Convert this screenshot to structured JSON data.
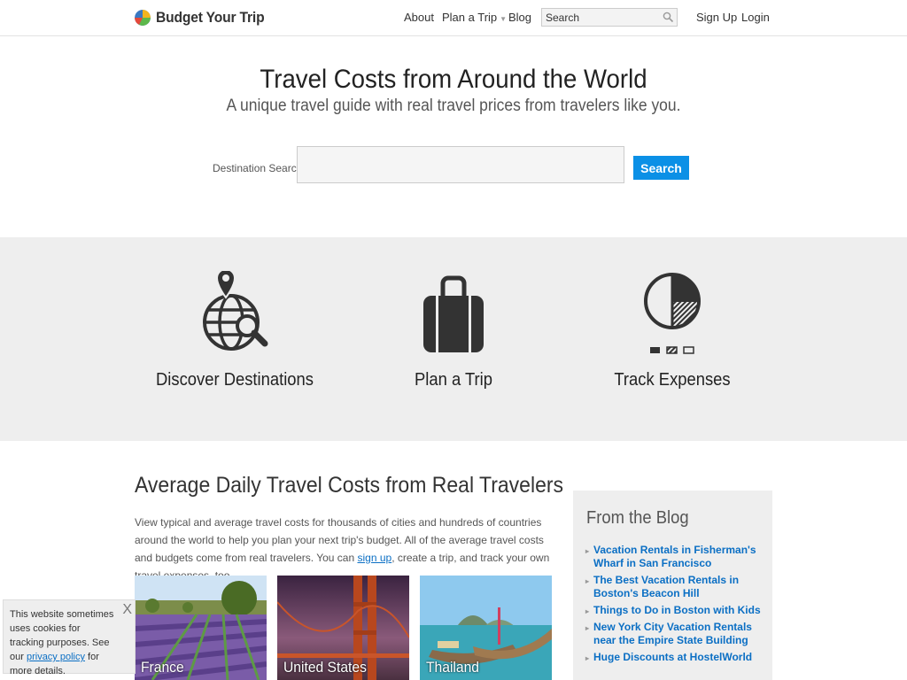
{
  "header": {
    "brand": "Budget Your Trip",
    "nav": {
      "about": "About",
      "plan_trip": "Plan a Trip",
      "blog": "Blog"
    },
    "search_placeholder": "Search",
    "signup": "Sign Up",
    "login": "Login"
  },
  "hero": {
    "title": "Travel Costs from Around the World",
    "subtitle": "A unique travel guide with real travel prices from travelers like you.",
    "search_label": "Destination Search:",
    "search_value": "",
    "search_button": "Search"
  },
  "features": [
    {
      "label": "Discover Destinations",
      "icon": "globe-search-icon"
    },
    {
      "label": "Plan a Trip",
      "icon": "suitcase-icon"
    },
    {
      "label": "Track Expenses",
      "icon": "pie-chart-icon"
    }
  ],
  "main": {
    "title": "Average Daily Travel Costs from Real Travelers",
    "text_before": "View typical and average travel costs for thousands of cities and hundreds of countries around the world to help you plan your next trip's budget. All of the average travel costs and budgets come from real travelers. You can ",
    "link": "sign up",
    "text_after": ", create a trip, and track your own travel expenses, too.",
    "destinations": [
      "France",
      "United States",
      "Thailand"
    ]
  },
  "blog": {
    "title": "From the Blog",
    "posts": [
      "Vacation Rentals in Fisherman's Wharf in San Francisco",
      "The Best Vacation Rentals in Boston's Beacon Hill",
      "Things to Do in Boston with Kids",
      "New York City Vacation Rentals near the Empire State Building",
      "Huge Discounts at HostelWorld"
    ]
  },
  "cookie": {
    "text_before": "This website sometimes uses cookies for tracking purposes. See our ",
    "link": "privacy policy",
    "text_after": " for more details.",
    "close": "X"
  },
  "colors": {
    "accent": "#0b90e6",
    "link": "#0b6fc4",
    "band": "#eeeeee"
  }
}
